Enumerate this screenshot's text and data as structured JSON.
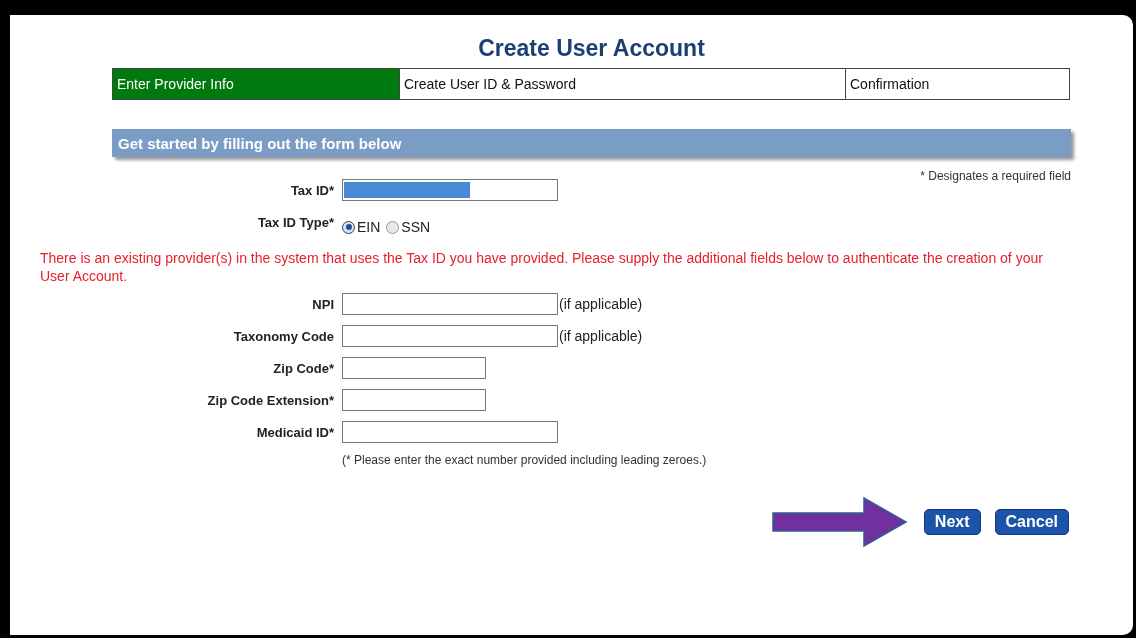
{
  "title": "Create User Account",
  "steps": [
    {
      "label": "Enter Provider Info",
      "selected": true
    },
    {
      "label": "Create User ID & Password",
      "selected": false
    },
    {
      "label": "Confirmation",
      "selected": false
    }
  ],
  "banner": "Get started by filling out the form below",
  "required_note": "* Designates a required field",
  "fields_top": [
    {
      "kind": "text",
      "label": "Tax ID*",
      "highlighted": true
    },
    {
      "kind": "radio",
      "label": "Tax ID Type*",
      "options": [
        {
          "label": "EIN",
          "selected": true
        },
        {
          "label": "SSN",
          "selected": false
        }
      ]
    }
  ],
  "error": "There is an existing provider(s) in the system that uses the Tax ID you have provided. Please supply the additional fields below to authenticate the creation of your User Account.",
  "fields": [
    {
      "kind": "text",
      "label": "NPI",
      "highlighted": false,
      "suffix": "(if applicable)"
    },
    {
      "kind": "text",
      "label": "Taxonomy Code",
      "highlighted": false,
      "suffix": "(if applicable)"
    },
    {
      "kind": "short_text",
      "label": "Zip Code*",
      "highlighted": false
    },
    {
      "kind": "short_text",
      "label": "Zip Code Extension*",
      "highlighted": false
    },
    {
      "kind": "text",
      "label": "Medicaid ID*",
      "highlighted": false
    }
  ],
  "hint": "(* Please enter the exact number provided including leading zeroes.)",
  "buttons": [
    "Next",
    "Cancel"
  ]
}
